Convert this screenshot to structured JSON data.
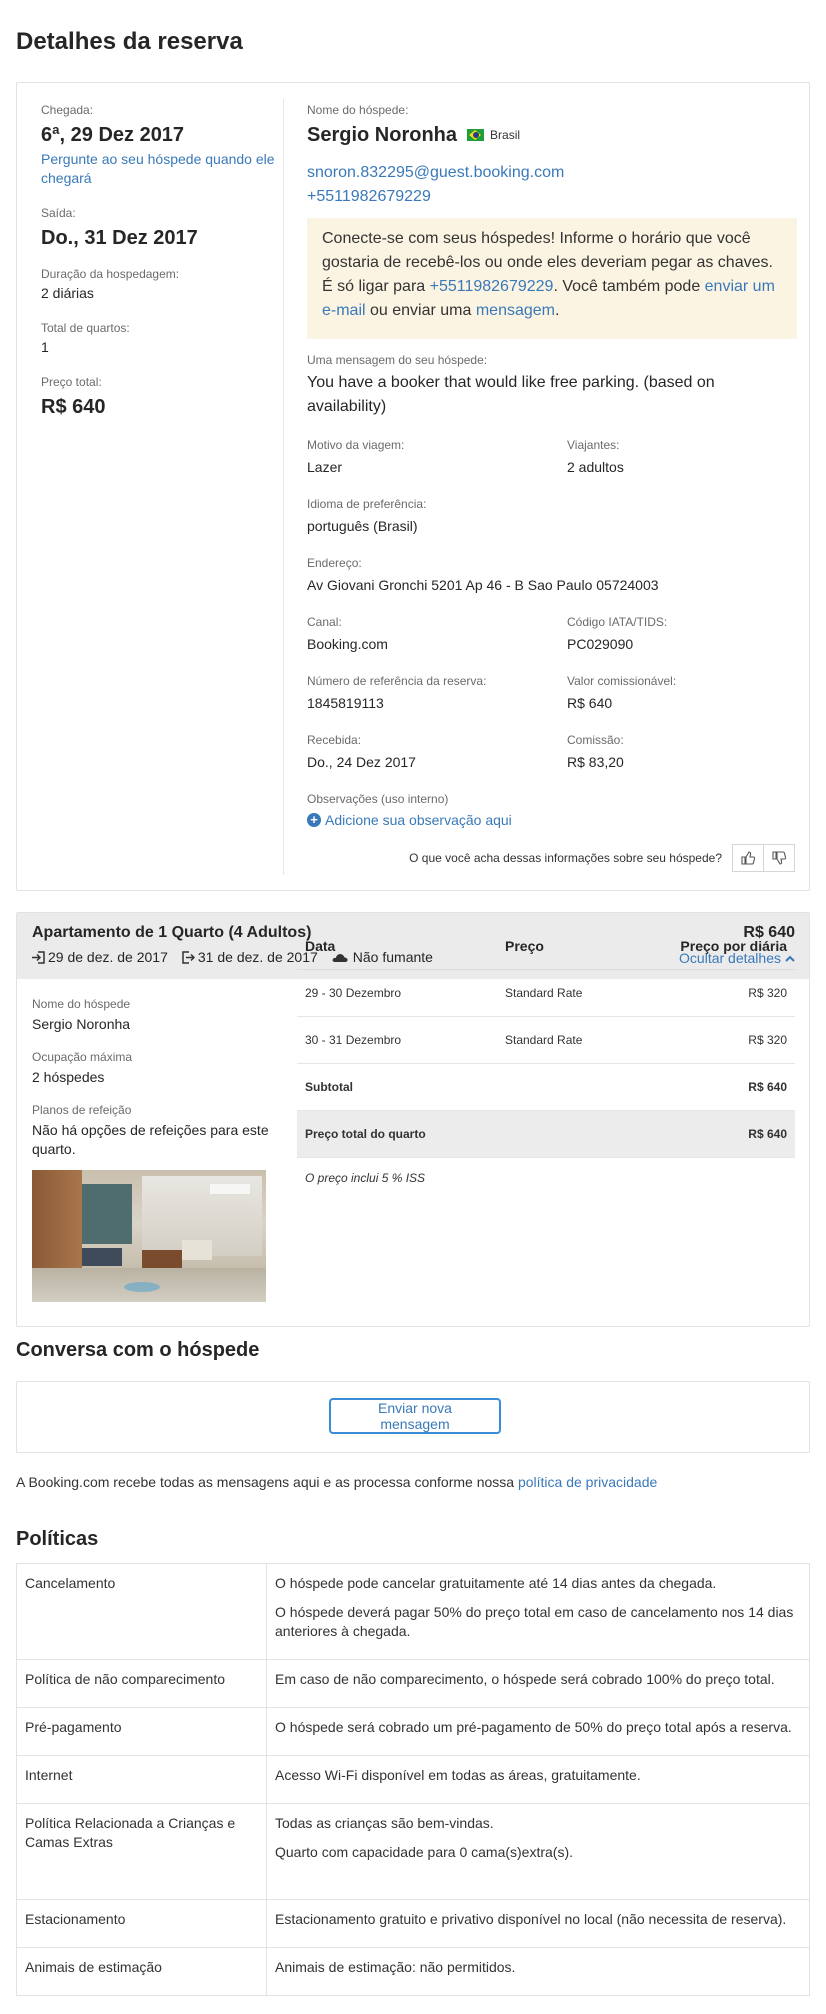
{
  "page": {
    "title": "Detalhes da reserva"
  },
  "summary": {
    "arrival_label": "Chegada:",
    "arrival_value": "6ª, 29 Dez 2017",
    "arrival_link": "Pergunte ao seu hóspede quando ele chegará",
    "departure_label": "Saída:",
    "departure_value": "Do., 31 Dez 2017",
    "duration_label": "Duração da hospedagem:",
    "duration_value": "2 diárias",
    "rooms_label": "Total de quartos:",
    "rooms_value": "1",
    "price_label": "Preço total:",
    "price_value": "R$ 640"
  },
  "guest": {
    "name_label": "Nome do hóspede:",
    "name": "Sergio Noronha",
    "country": "Brasil",
    "email": "snoron.832295@guest.booking.com",
    "phone": "+5511982679229",
    "notice_part1": "Conecte-se com seus hóspedes! Informe o horário que você gostaria de recebê-los ou onde eles deveriam pegar as chaves. É só ligar para ",
    "notice_phone": "+5511982679229",
    "notice_part2": ". Você também pode ",
    "notice_email_link": "enviar um e-mail",
    "notice_part3": " ou enviar uma ",
    "notice_message_link": "mensagem",
    "notice_part4": ".",
    "message_label": "Uma mensagem do seu hóspede:",
    "message": "You have a booker that would like free parking. (based on availability)",
    "purpose_label": "Motivo da viagem:",
    "purpose": "Lazer",
    "travelers_label": "Viajantes:",
    "travelers": "2 adultos",
    "language_label": "Idioma de preferência:",
    "language": "português (Brasil)",
    "address_label": "Endereço:",
    "address": "Av Giovani Gronchi 5201 Ap 46 - B Sao Paulo 05724003",
    "channel_label": "Canal:",
    "channel": "Booking.com",
    "iata_label": "Código IATA/TIDS:",
    "iata": "PC029090",
    "ref_label": "Número de referência da reserva:",
    "ref": "1845819113",
    "commissionable_label": "Valor comissionável:",
    "commissionable": "R$ 640",
    "received_label": "Recebida:",
    "received": "Do., 24 Dez 2017",
    "commission_label": "Comissão:",
    "commission": "R$ 83,20",
    "notes_label": "Observações (uso interno)",
    "notes_link": "Adicione sua observação aqui",
    "feedback_question": "O que você acha dessas informações sobre seu hóspede?"
  },
  "room": {
    "title": "Apartamento de 1 Quarto (4 Adultos)",
    "price": "R$ 640",
    "checkin": "29 de dez. de 2017",
    "checkout": "31 de dez. de 2017",
    "smoking": "Não fumante",
    "hide_details": "Ocultar detalhes",
    "guest_name_label": "Nome do hóspede",
    "guest_name": "Sergio Noronha",
    "occupancy_label": "Ocupação máxima",
    "occupancy": "2 hóspedes",
    "meal_label": "Planos de refeição",
    "meal": "Não há opções de refeições para este quarto.",
    "table_headers": [
      "Data",
      "Preço",
      "Preço por diária"
    ],
    "rows": [
      [
        "29 - 30 Dezembro",
        "Standard Rate",
        "R$ 320"
      ],
      [
        "30 - 31 Dezembro",
        "Standard Rate",
        "R$ 320"
      ]
    ],
    "subtotal_label": "Subtotal",
    "subtotal": "R$ 640",
    "total_label": "Preço total do quarto",
    "total": "R$ 640",
    "tax_note": "O preço inclui 5 % ISS"
  },
  "conversation": {
    "title": "Conversa com o hóspede",
    "button": "Enviar nova mensagem",
    "note": "A Booking.com recebe todas as mensagens aqui e as processa conforme nossa ",
    "note_link": "política de privacidade"
  },
  "policies": {
    "title": "Políticas",
    "rows": [
      {
        "name": "Cancelamento",
        "lines": [
          "O hóspede pode cancelar gratuitamente até 14 dias antes da chegada.",
          "O hóspede deverá pagar 50% do preço total em caso de cancelamento nos 14 dias anteriores à chegada."
        ]
      },
      {
        "name": "Política de não comparecimento",
        "lines": [
          "Em caso de não comparecimento, o hóspede será cobrado 100% do preço total."
        ]
      },
      {
        "name": "Pré-pagamento",
        "lines": [
          "O hóspede será cobrado um pré-pagamento de 50% do preço total após a reserva."
        ]
      },
      {
        "name": "Internet",
        "lines": [
          "Acesso Wi-Fi disponível em todas as áreas, gratuitamente."
        ]
      },
      {
        "name": "Política Relacionada a Crianças e Camas Extras",
        "lines": [
          "Todas as crianças são bem-vindas.",
          "Quarto com capacidade para 0 cama(s)extra(s)."
        ]
      },
      {
        "name": "Estacionamento",
        "lines": [
          "Estacionamento gratuito e privativo disponível no local (não necessita de reserva)."
        ]
      },
      {
        "name": "Animais de estimação",
        "lines": [
          "Animais de estimação: não permitidos."
        ]
      }
    ]
  }
}
